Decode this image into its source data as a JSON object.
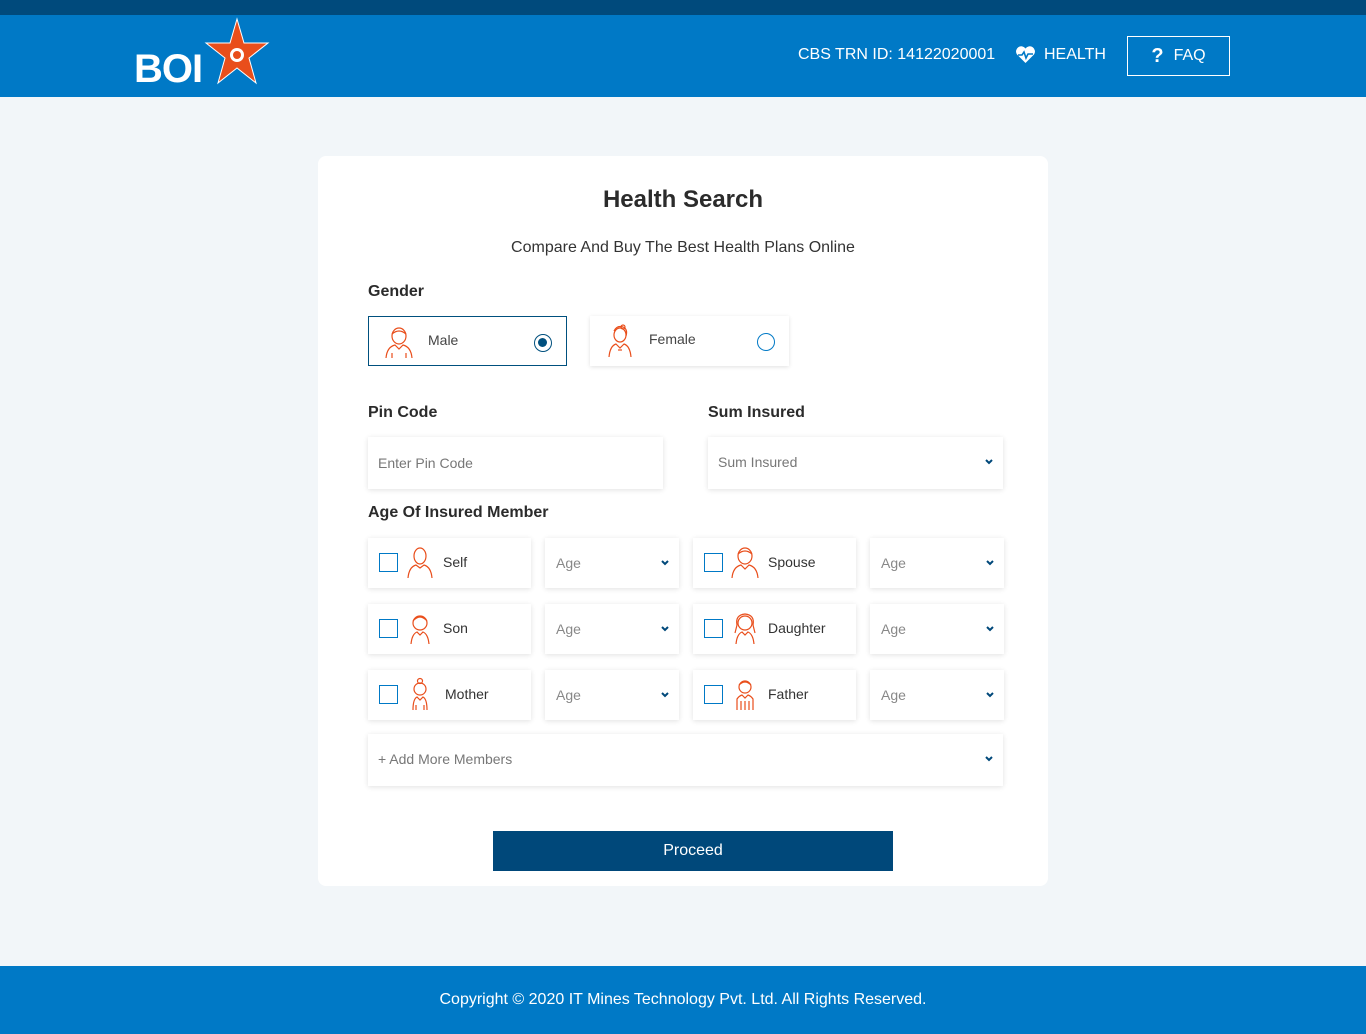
{
  "header": {
    "logo_text": "BOI",
    "trn_label": "CBS TRN ID: 14122020001",
    "health_label": "HEALTH",
    "faq_label": "FAQ",
    "colors": {
      "header": "#0079c6",
      "strip": "#004a7c",
      "accent": "#e94e1b"
    }
  },
  "form": {
    "title": "Health Search",
    "subtitle": "Compare And Buy The Best Health Plans Online",
    "gender_label": "Gender",
    "genders": [
      {
        "label": "Male",
        "selected": true,
        "icon": "male-avatar-icon"
      },
      {
        "label": "Female",
        "selected": false,
        "icon": "female-avatar-icon"
      }
    ],
    "pincode_label": "Pin Code",
    "pincode_placeholder": "Enter Pin Code",
    "pincode_value": "",
    "sum_insured_label": "Sum Insured",
    "sum_insured_value": "Sum Insured",
    "age_label": "Age Of Insured Member",
    "members": [
      {
        "label": "Self",
        "checked": false,
        "age": "Age",
        "icon": "self-avatar-icon"
      },
      {
        "label": "Spouse",
        "checked": false,
        "age": "Age",
        "icon": "spouse-avatar-icon"
      },
      {
        "label": "Son",
        "checked": false,
        "age": "Age",
        "icon": "son-avatar-icon"
      },
      {
        "label": "Daughter",
        "checked": false,
        "age": "Age",
        "icon": "daughter-avatar-icon"
      },
      {
        "label": "Mother",
        "checked": false,
        "age": "Age",
        "icon": "mother-avatar-icon"
      },
      {
        "label": "Father",
        "checked": false,
        "age": "Age",
        "icon": "father-avatar-icon"
      }
    ],
    "add_more_label": "+ Add More Members",
    "proceed_label": "Proceed"
  },
  "footer": {
    "copyright": "Copyright © 2020 IT Mines Technology Pvt. Ltd. All Rights Reserved."
  }
}
